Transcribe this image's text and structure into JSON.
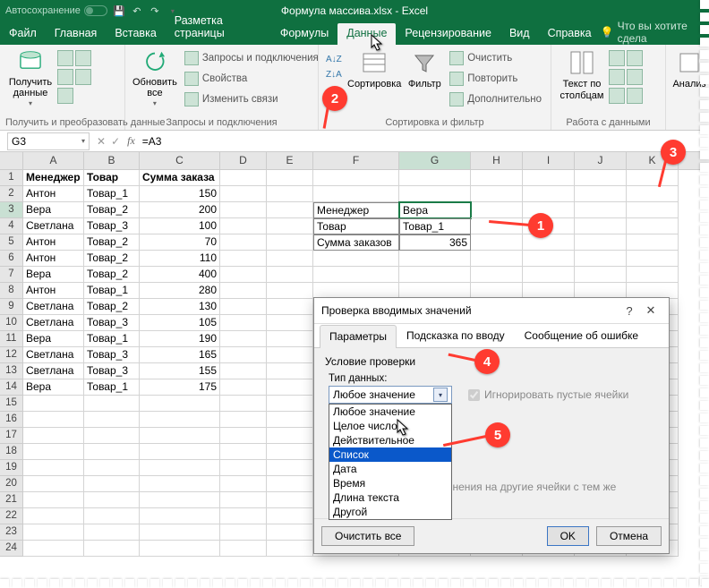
{
  "titlebar": {
    "autosave_label": "Автосохранение",
    "doc_title": "Формула массива.xlsx - Excel"
  },
  "menu": {
    "tabs": [
      "Файл",
      "Главная",
      "Вставка",
      "Разметка страницы",
      "Формулы",
      "Данные",
      "Рецензирование",
      "Вид",
      "Справка"
    ],
    "active_index": 5,
    "tell_me": "Что вы хотите сдела"
  },
  "ribbon": {
    "get_data": "Получить данные",
    "group_transform": "Получить и преобразовать данные",
    "refresh_all": "Обновить все",
    "queries": "Запросы и подключения",
    "properties": "Свойства",
    "edit_links": "Изменить связи",
    "group_queries": "Запросы и подключения",
    "sort": "Сортировка",
    "filter": "Фильтр",
    "clear": "Очистить",
    "reapply": "Повторить",
    "advanced": "Дополнительно",
    "group_sortfilter": "Сортировка и фильтр",
    "text_to_columns": "Текст по столбцам",
    "group_datatools": "Работа с данными",
    "analysis": "Анализ"
  },
  "formula_bar": {
    "name_box": "G3",
    "formula": "=A3"
  },
  "grid": {
    "cols": [
      "A",
      "B",
      "C",
      "D",
      "E",
      "F",
      "G",
      "H",
      "I",
      "J",
      "K"
    ],
    "headers": {
      "a": "Менеджер",
      "b": "Товар",
      "c": "Сумма заказа"
    },
    "data": [
      {
        "a": "Антон",
        "b": "Товар_1",
        "c": 150
      },
      {
        "a": "Вера",
        "b": "Товар_2",
        "c": 200
      },
      {
        "a": "Светлана",
        "b": "Товар_3",
        "c": 100
      },
      {
        "a": "Антон",
        "b": "Товар_2",
        "c": 70
      },
      {
        "a": "Антон",
        "b": "Товар_2",
        "c": 110
      },
      {
        "a": "Вера",
        "b": "Товар_2",
        "c": 400
      },
      {
        "a": "Антон",
        "b": "Товар_1",
        "c": 280
      },
      {
        "a": "Светлана",
        "b": "Товар_2",
        "c": 130
      },
      {
        "a": "Светлана",
        "b": "Товар_3",
        "c": 105
      },
      {
        "a": "Вера",
        "b": "Товар_1",
        "c": 190
      },
      {
        "a": "Светлана",
        "b": "Товар_3",
        "c": 165
      },
      {
        "a": "Светлана",
        "b": "Товар_3",
        "c": 155
      },
      {
        "a": "Вера",
        "b": "Товар_1",
        "c": 175
      }
    ],
    "summary": {
      "f3": "Менеджер",
      "g3": "Вера",
      "f4": "Товар",
      "g4": "Товар_1",
      "f5": "Сумма заказов",
      "g5": 365
    }
  },
  "dialog": {
    "title": "Проверка вводимых значений",
    "tabs": [
      "Параметры",
      "Подсказка по вводу",
      "Сообщение об ошибке"
    ],
    "active_tab": 0,
    "cond_label": "Условие проверки",
    "type_label": "Тип данных:",
    "type_selected": "Любое значение",
    "type_options": [
      "Любое значение",
      "Целое число",
      "Действительное",
      "Список",
      "Дата",
      "Время",
      "Длина текста",
      "Другой"
    ],
    "type_highlight_index": 3,
    "ignore_blank": "Игнорировать пустые ячейки",
    "propagate": "Распространить изменения на другие ячейки с тем же условием",
    "btn_clear": "Очистить все",
    "btn_ok": "OK",
    "btn_cancel": "Отмена"
  },
  "callouts": {
    "1": "1",
    "2": "2",
    "3": "3",
    "4": "4",
    "5": "5"
  }
}
